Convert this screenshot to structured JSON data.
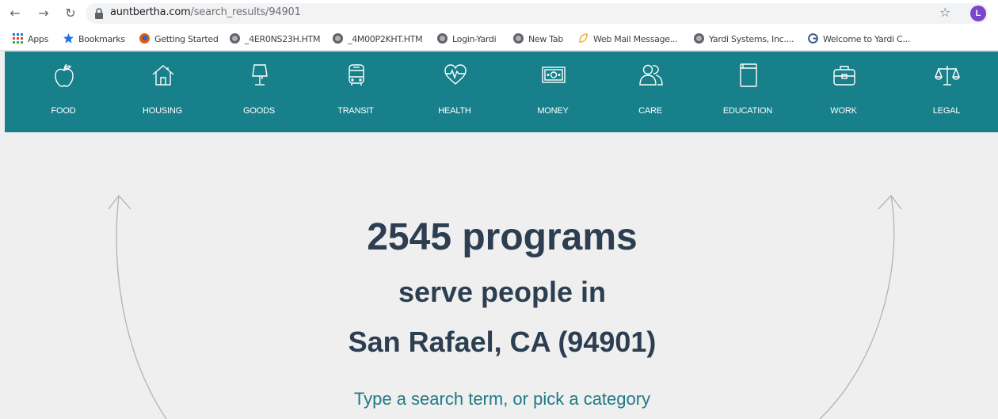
{
  "browser": {
    "url_host": "auntbertha.com",
    "url_path": "/search_results/94901",
    "profile_initial": "L",
    "bookmarks": [
      {
        "label": "Apps",
        "icon": "apps-grid-icon"
      },
      {
        "label": "Bookmarks",
        "icon": "star-icon"
      },
      {
        "label": "Getting Started",
        "icon": "firefox-icon"
      },
      {
        "label": "_4ER0NS23H.HTM",
        "icon": "globe-icon"
      },
      {
        "label": "_4M00P2KHT.HTM",
        "icon": "globe-icon"
      },
      {
        "label": "Login-Yardi",
        "icon": "globe-icon"
      },
      {
        "label": "New Tab",
        "icon": "globe-icon"
      },
      {
        "label": "Web Mail Message...",
        "icon": "webmail-icon"
      },
      {
        "label": "Yardi Systems, Inc....",
        "icon": "globe-icon"
      },
      {
        "label": "Welcome to Yardi C...",
        "icon": "yardi-logo-icon"
      }
    ]
  },
  "categories": [
    {
      "label": "FOOD",
      "icon": "apple-icon"
    },
    {
      "label": "HOUSING",
      "icon": "house-icon"
    },
    {
      "label": "GOODS",
      "icon": "lamp-icon"
    },
    {
      "label": "TRANSIT",
      "icon": "bus-icon"
    },
    {
      "label": "HEALTH",
      "icon": "heart-pulse-icon"
    },
    {
      "label": "MONEY",
      "icon": "banknote-icon"
    },
    {
      "label": "CARE",
      "icon": "people-icon"
    },
    {
      "label": "EDUCATION",
      "icon": "book-icon"
    },
    {
      "label": "WORK",
      "icon": "briefcase-icon"
    },
    {
      "label": "LEGAL",
      "icon": "scales-icon"
    }
  ],
  "hero": {
    "count_line": "2545 programs",
    "serve_line": "serve people in",
    "location_line": "San Rafael, CA (94901)",
    "hint": "Type a search term, or pick a category"
  },
  "colors": {
    "nav_bg": "#17808a",
    "heading": "#2c3e50",
    "hint": "#1f7a85",
    "avatar": "#7b45c9"
  }
}
